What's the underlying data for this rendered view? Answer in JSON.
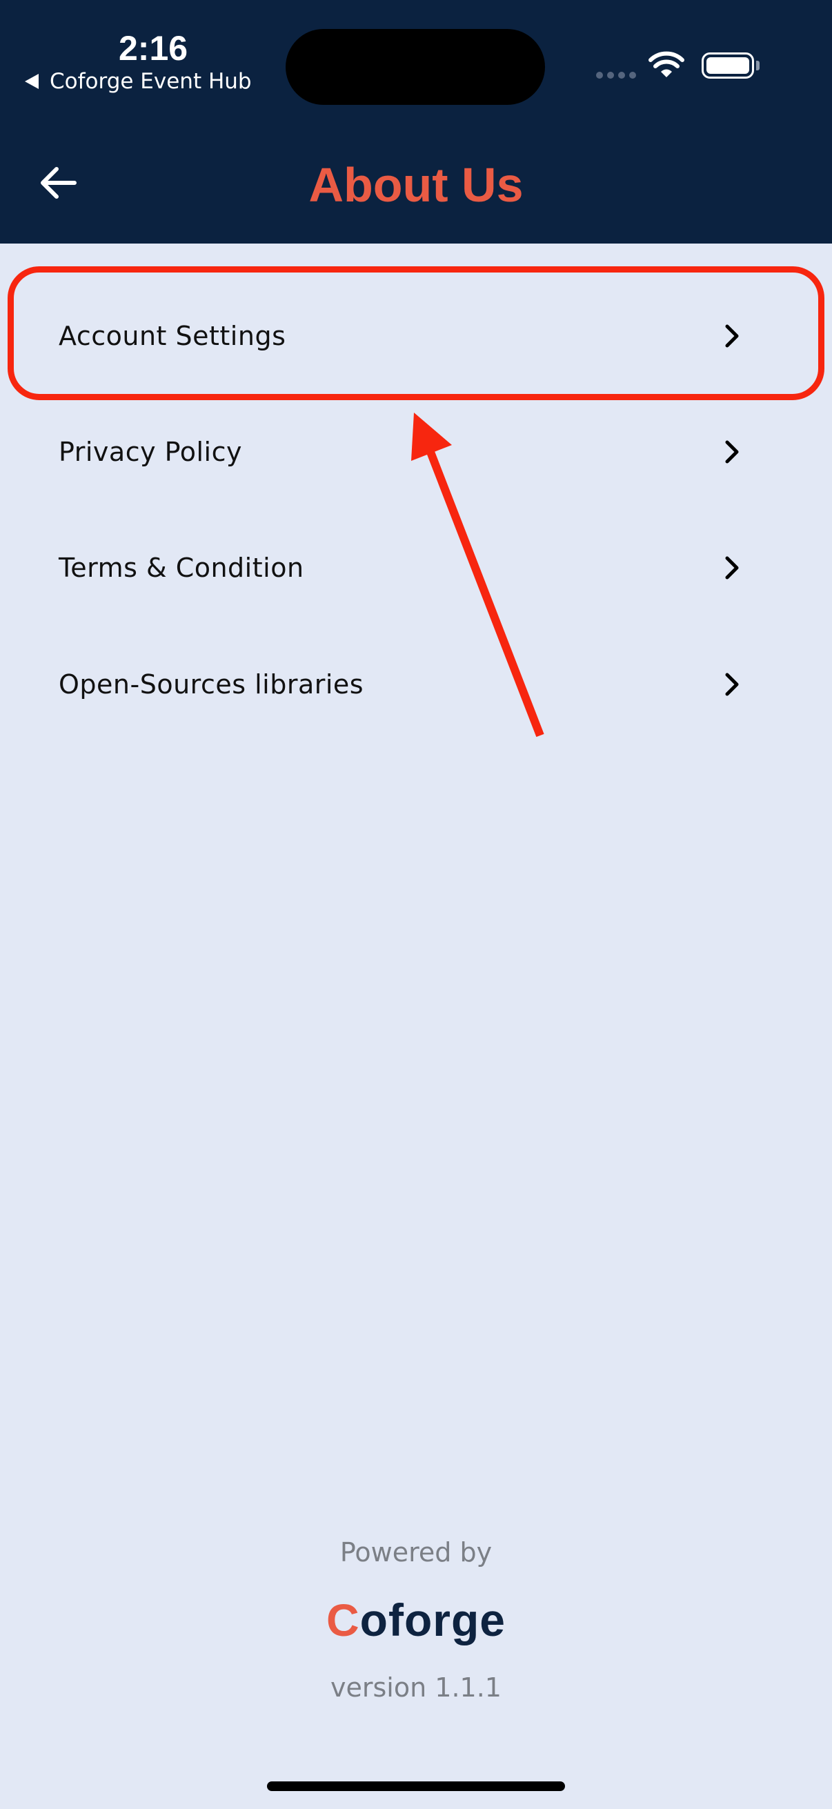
{
  "status_bar": {
    "time": "2:16",
    "back_app": "Coforge Event Hub",
    "icons": [
      "cellular-signal-icon",
      "wifi-icon",
      "battery-icon"
    ]
  },
  "header": {
    "title": "About Us",
    "back_icon": "arrow-left-icon"
  },
  "menu": {
    "items": [
      {
        "label": "Account Settings",
        "icon": "chevron-right-icon"
      },
      {
        "label": "Privacy Policy",
        "icon": "chevron-right-icon"
      },
      {
        "label": "Terms & Condition",
        "icon": "chevron-right-icon"
      },
      {
        "label": "Open-Sources libraries",
        "icon": "chevron-right-icon"
      }
    ]
  },
  "footer": {
    "powered_by": "Powered by",
    "logo_first": "C",
    "logo_rest": "oforge",
    "version": "version 1.1.1"
  },
  "colors": {
    "header_bg": "#0b2240",
    "title": "#ea5b44",
    "page_bg": "#e2e8f5",
    "annotation": "#f7260f",
    "logo_dark": "#0e2340"
  }
}
